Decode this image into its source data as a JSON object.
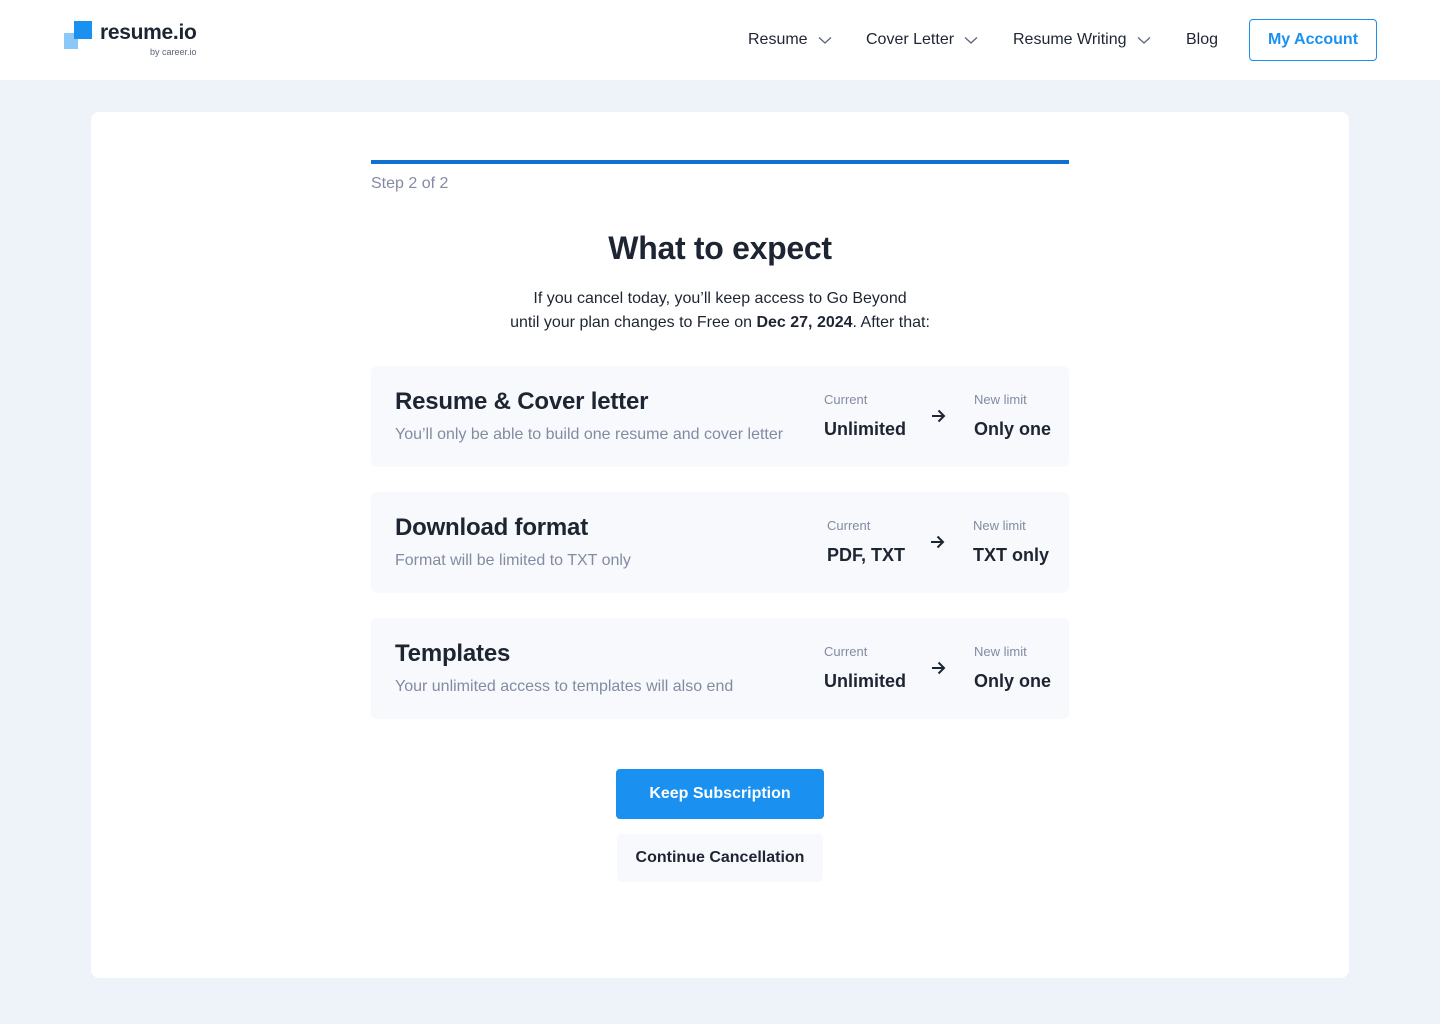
{
  "header": {
    "logo": {
      "name": "resume.io",
      "sub": "by career.io"
    },
    "nav": [
      {
        "label": "Resume",
        "dropdown": true
      },
      {
        "label": "Cover Letter",
        "dropdown": true
      },
      {
        "label": "Resume Writing",
        "dropdown": true
      },
      {
        "label": "Blog",
        "dropdown": false
      }
    ],
    "account_label": "My Account"
  },
  "main": {
    "progress": 1.0,
    "step": "Step 2 of 2",
    "title": "What to expect",
    "desc_line1": "If you cancel today, you’ll keep access to Go Beyond",
    "desc_line2_pre": "until your plan changes to Free on ",
    "desc_date": "Dec 27, 2024",
    "desc_line2_post": ". After that:",
    "features": [
      {
        "title": "Resume & Cover letter",
        "desc": "You’ll only be able to build one resume and cover letter",
        "current_label": "Current",
        "current_value": "Unlimited",
        "new_label": "New limit",
        "new_value": "Only one"
      },
      {
        "title": "Download format",
        "desc": "Format will be limited to TXT only",
        "current_label": "Current",
        "current_value": "PDF, TXT",
        "new_label": "New limit",
        "new_value": "TXT only"
      },
      {
        "title": "Templates",
        "desc": "Your unlimited access to templates will also end",
        "current_label": "Current",
        "current_value": "Unlimited",
        "new_label": "New limit",
        "new_value": "Only one"
      }
    ],
    "keep_label": "Keep Subscription",
    "continue_label": "Continue Cancellation"
  },
  "colors": {
    "accent": "#1a91f0",
    "progress": "#1170cd",
    "page_bg": "#eef2f9",
    "text": "#1e2532",
    "muted": "#828ba2"
  }
}
